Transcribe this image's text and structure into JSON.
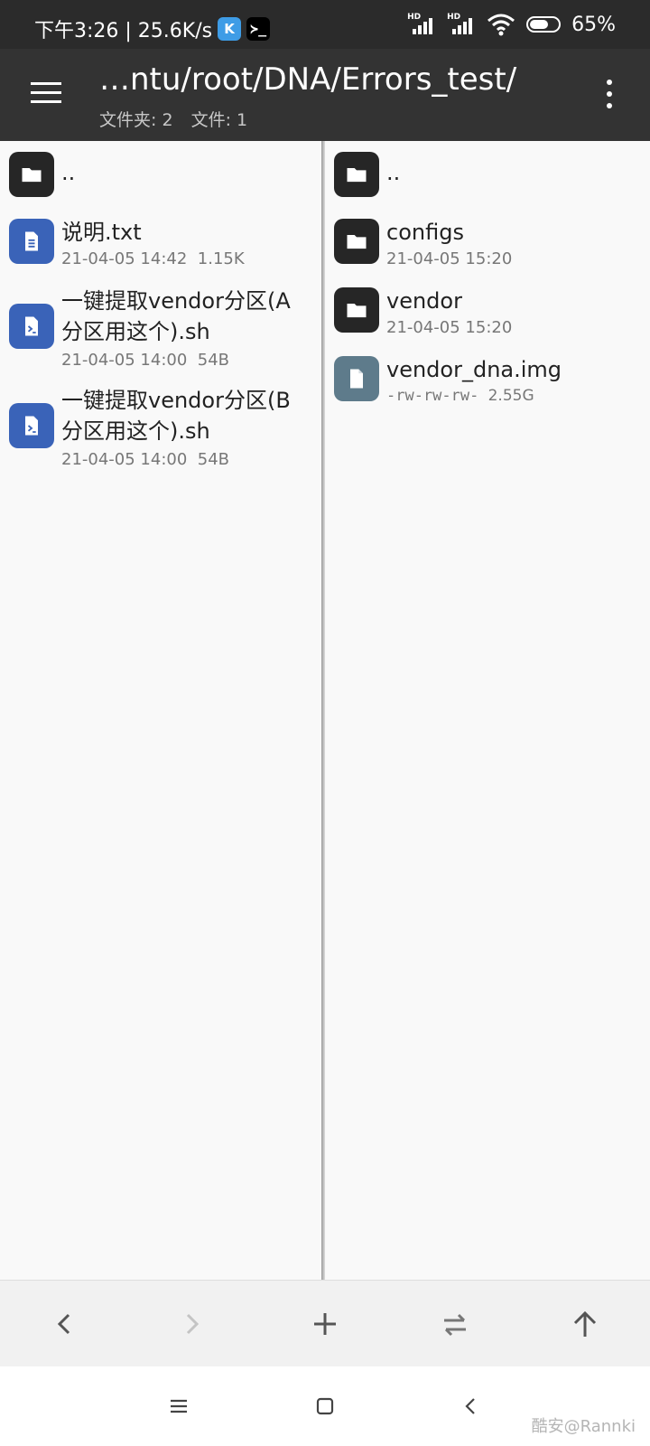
{
  "status_bar": {
    "time_speed": "下午3:26 | 25.6K/s",
    "badge_k": "K",
    "badge_terminal": "≻_",
    "hd1": "HD",
    "hd2": "HD",
    "battery": "65%",
    "battery_level": 0.65
  },
  "toolbar": {
    "path": "…ntu/root/DNA/Errors_test/",
    "folders_label": "文件夹: 2",
    "files_label": "文件: 1"
  },
  "left_pane": {
    "items": [
      {
        "name": "..",
        "type": "folder",
        "icon": "folder-icon"
      },
      {
        "name": "说明.txt",
        "type": "text",
        "icon": "text-file-icon",
        "date": "21-04-05 14:42",
        "size": "1.15K"
      },
      {
        "name": "一键提取vendor分区(A分区用这个).sh",
        "name_line1": "一键提取vendor分区(A",
        "name_line2": "分区用这个).sh",
        "type": "script",
        "icon": "script-file-icon",
        "date": "21-04-05 14:00",
        "size": "54B"
      },
      {
        "name": "一键提取vendor分区(B分区用这个).sh",
        "name_line1": "一键提取vendor分区(B",
        "name_line2": "分区用这个).sh",
        "type": "script",
        "icon": "script-file-icon",
        "date": "21-04-05 14:00",
        "size": "54B"
      }
    ]
  },
  "right_pane": {
    "items": [
      {
        "name": "..",
        "type": "folder",
        "icon": "folder-icon"
      },
      {
        "name": "configs",
        "type": "folder",
        "icon": "folder-icon",
        "date": "21-04-05 15:20"
      },
      {
        "name": "vendor",
        "type": "folder",
        "icon": "folder-icon",
        "date": "21-04-05 15:20"
      },
      {
        "name": "vendor_dna.img",
        "type": "file",
        "icon": "file-icon",
        "perms": "-rw-rw-rw-",
        "size": "2.55G"
      }
    ]
  },
  "action_bar": [
    "back-arrow-icon",
    "forward-arrow-icon",
    "add-icon",
    "swap-icon",
    "up-arrow-icon"
  ],
  "nav_bar": [
    "menu-icon",
    "home-icon",
    "back-icon"
  ],
  "watermark": "酷安@Rannki",
  "colors": {
    "toolbar": "#333333",
    "doc_icon": "#3a63b8",
    "folder_icon": "#262626",
    "img_icon": "#5e7b8b"
  }
}
